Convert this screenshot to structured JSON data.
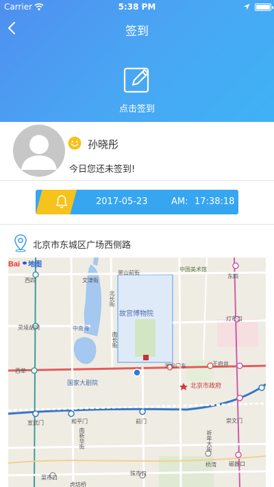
{
  "status_bar": {
    "carrier": "Carrier",
    "time": "5:38 PM"
  },
  "nav": {
    "title": "签到"
  },
  "hero": {
    "checkin_label": "点击签到"
  },
  "profile": {
    "name": "孙晓彤",
    "status": "今日您还未签到!"
  },
  "timebar": {
    "date": "2017-05-23",
    "ampm": "AM:",
    "clock": "17:38:18"
  },
  "location": {
    "address": "北京市东城区广场西侧路"
  },
  "map": {
    "labels": {
      "xisi": "西四",
      "wenjin": "文津街",
      "jingshan": "景山前街",
      "zgmsg": "中国美术馆",
      "dongsi": "东四",
      "beichang": "北长街",
      "gugong": "故宫博物院",
      "lingjing": "灵境胡同",
      "dengshikou": "灯市口",
      "zhongnanhai": "中南海",
      "nanchang": "南长街",
      "xidan": "西单",
      "tiananmendong": "天安门东",
      "wangfujing": "王府井",
      "guojia": "国家大剧院",
      "zhengfu": "北京市政府",
      "xuanwumen": "宣武门",
      "hepingmen": "和平门",
      "qianmen": "前门",
      "chongwenmen": "崇文门",
      "nanxinhua": "南新华街",
      "qinian": "祈年大街",
      "caishikou": "菜市口",
      "zhushikou": "珠市口",
      "qiaowan": "桥湾",
      "ciqikou": "磁器口",
      "hufangqiao": "虎坊桥",
      "baidu": "Bai du 地图"
    }
  },
  "colors": {
    "hero_start": "#4f8ff0",
    "hero_end": "#3fb2f5",
    "timebar": "#36a6f0",
    "accent": "#f5c31c"
  }
}
